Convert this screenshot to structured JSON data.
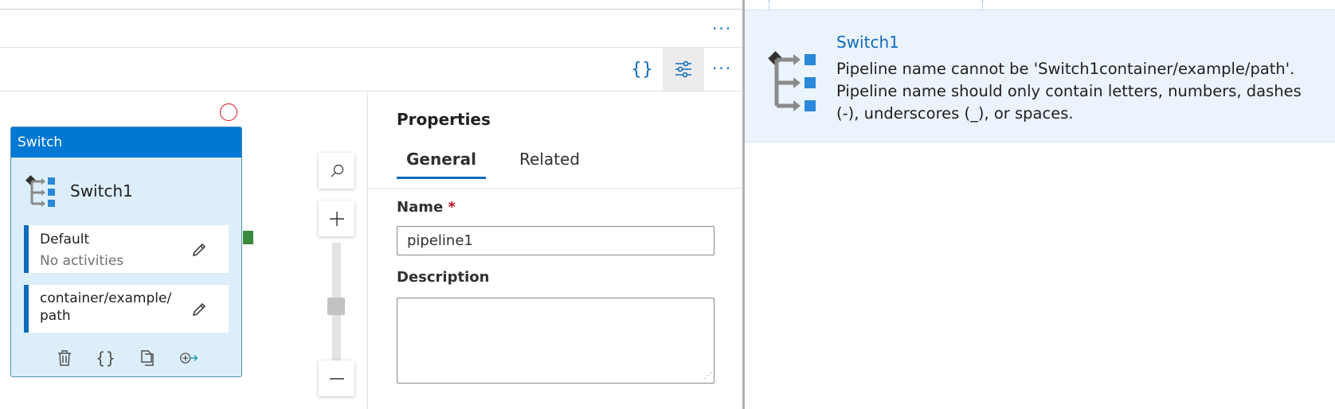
{
  "toolbar": {
    "more_label": "···",
    "code_label": "{}"
  },
  "canvas": {
    "switch_activity": {
      "header": "Switch",
      "name": "Switch1",
      "cases": [
        {
          "label": "Default",
          "sublabel": "No activities"
        },
        {
          "label": "container/example/\npath",
          "sublabel": ""
        }
      ],
      "action_icons": [
        "delete-icon",
        "code-icon",
        "copy-icon",
        "add-output-icon"
      ]
    },
    "zoom": {
      "level_fraction": 0.55
    }
  },
  "properties": {
    "title": "Properties",
    "tabs": [
      {
        "label": "General",
        "active": true
      },
      {
        "label": "Related",
        "active": false
      }
    ],
    "name_label": "Name",
    "required_mark": "*",
    "name_value": "pipeline1",
    "description_label": "Description",
    "description_value": ""
  },
  "error_tooltip": {
    "title": "Switch1",
    "message": "Pipeline name cannot be 'Switch1container/example/path'. Pipeline name should only contain letters, numbers, dashes (-), underscores (_), or spaces."
  },
  "colors": {
    "accent": "#0f6cbd",
    "switch_header": "#0078d4",
    "card_bg": "#ddeefb",
    "tooltip_bg": "#ebf3fc",
    "error_red": "#e00b1c",
    "port_green": "#3a8a3d"
  }
}
